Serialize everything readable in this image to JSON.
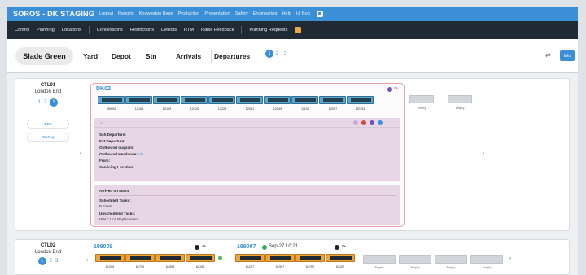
{
  "topbar": {
    "brand": "SOROS - DK STAGING",
    "items": [
      "Logout",
      "Reports",
      "Knowledge Base",
      "Production",
      "Presentation",
      "Safety",
      "Engineering",
      "Help",
      "Hi Bob"
    ]
  },
  "subnav": {
    "items": [
      "Control",
      "Planning",
      "Locations",
      "Concessions",
      "Restrictions",
      "Defects",
      "RTM",
      "Raise Feedback",
      "Planning Requests"
    ]
  },
  "tabs": {
    "site": "Slade Green",
    "views": [
      "Yard",
      "Depot",
      "Stn",
      "Arrivals",
      "Departures"
    ],
    "pages": [
      "1",
      "2",
      "3"
    ],
    "info_label": "Info"
  },
  "colors": {
    "accent": "#3a8fd6",
    "unit_blue": "#5aa6cf",
    "unit_orange": "#f0a436",
    "panel_purple": "#e6d6e6",
    "alert_red": "#e4a1a6"
  },
  "row1": {
    "ctl_id": "CTL01",
    "ctl_end": "London End",
    "pages": [
      "1",
      "2",
      "3"
    ],
    "buttons": [
      "DET",
      "Testing"
    ],
    "unit_id": "DK02",
    "cars": [
      "99002",
      "12105",
      "12109",
      "12120",
      "12224",
      "12051",
      "12049",
      "11100",
      "12097",
      "82103"
    ],
    "empty_label": "Empty",
    "details": {
      "labels": [
        "Sch Departure:",
        "Est Departure:",
        "Outbound diagram:",
        "Outbound Headcode:",
        "From:",
        "Servicing Location:"
      ],
      "headcode_value": "n/a",
      "maint_title": "Arrived on Maint",
      "scheduled_title": "Scheduled Tasks:",
      "scheduled_value": "B Exam",
      "unscheduled_title": "Unscheduled Tasks:",
      "unscheduled_value": "HVAC Unit Replacement"
    }
  },
  "row2": {
    "ctl_id": "CTL02",
    "ctl_end": "London End",
    "pages": [
      "1",
      "2",
      "3"
    ],
    "unit_a": "199009",
    "unit_a_cars": [
      "61209",
      "61709",
      "61909",
      "62109"
    ],
    "unit_b": "199007",
    "unit_b_date": "Sep-27 10:21",
    "unit_b_cars": [
      "61207",
      "61907",
      "61707",
      "62107"
    ],
    "empty_label": "Empty"
  }
}
